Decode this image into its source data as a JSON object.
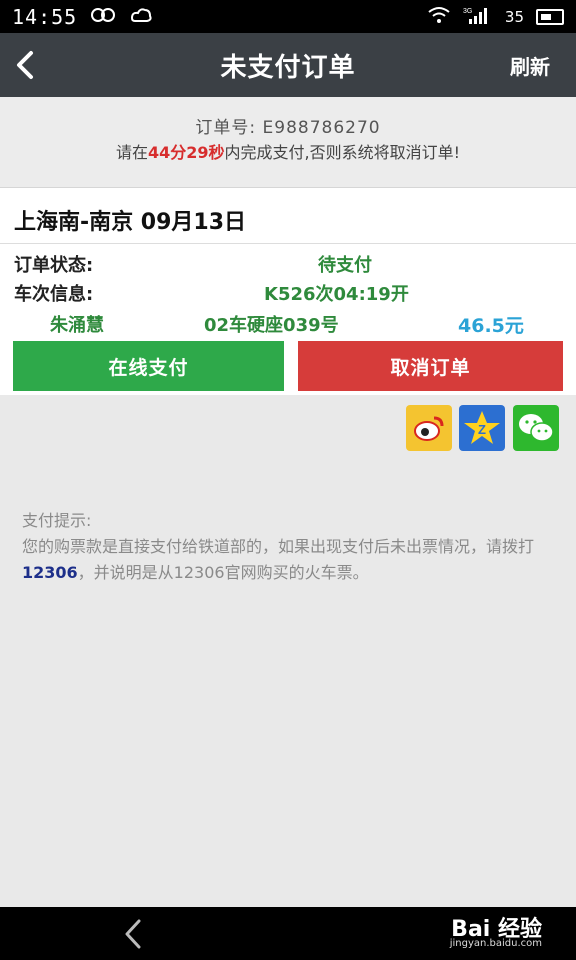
{
  "status_bar": {
    "time": "14:55",
    "network": "3G",
    "signal_text": "35",
    "icons": [
      "infinity-icon",
      "cloud-icon",
      "wifi-icon",
      "signal-icon",
      "battery-icon"
    ]
  },
  "header": {
    "title": "未支付订单",
    "refresh_label": "刷新"
  },
  "order": {
    "number_label": "订单号:",
    "number_value": "E988786270",
    "countdown_prefix": "请在",
    "countdown_time": "44分29秒",
    "countdown_suffix": "内完成支付,否则系统将取消订单!"
  },
  "trip": {
    "route": "上海南-南京 09月13日",
    "status_label": "订单状态:",
    "status_value": "待支付",
    "train_label": "车次信息:",
    "train_value": "K526次04:19开",
    "passenger_name": "朱涌慧",
    "seat": "02车硬座039号",
    "price": "46.5元"
  },
  "actions": {
    "pay_label": "在线支付",
    "cancel_label": "取消订单"
  },
  "share": {
    "icons": [
      "weibo-icon",
      "qzone-icon",
      "wechat-icon"
    ]
  },
  "tips": {
    "title": "支付提示:",
    "line_before": "您的购票款是直接支付给铁道部的，如果出现支付后未出票情况，请拨打",
    "phone": "12306",
    "line_after": "，并说明是从12306官网购买的火车票。"
  },
  "navbar": {
    "watermark": "Bai 经验",
    "watermark_url": "jingyan.baidu.com"
  },
  "colors": {
    "header_bg": "#3b4045",
    "pay_green": "#2ea94a",
    "cancel_red": "#d63c3a",
    "accent_green": "#2f8a3c",
    "price_blue": "#2ba3d6",
    "countdown_red": "#d72d2d"
  }
}
